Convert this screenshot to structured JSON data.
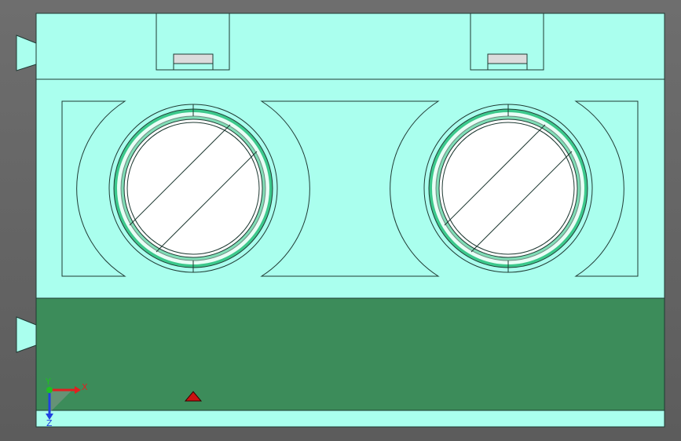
{
  "viewport": {
    "background_gradient": [
      "#6e6e6e",
      "#5c5c5c"
    ],
    "part_color": "#aaffee",
    "base_color": "#3c8c5a",
    "screw_ring_color": "#3cc88c",
    "edge_color": "#1f3a33",
    "screw_face_color": "#ffffff",
    "clamp_plate_color": "#dcdcdc"
  },
  "triad": {
    "x_label": "X",
    "y_label": "Y",
    "z_label": "Z",
    "x_color": "#e02020",
    "y_color": "#20c020",
    "z_color": "#2040e0"
  },
  "icons": {
    "origin_marker": "red-triangle-origin-icon",
    "triad": "coordinate-triad-icon"
  },
  "screws": [
    "left-screw",
    "right-screw"
  ]
}
